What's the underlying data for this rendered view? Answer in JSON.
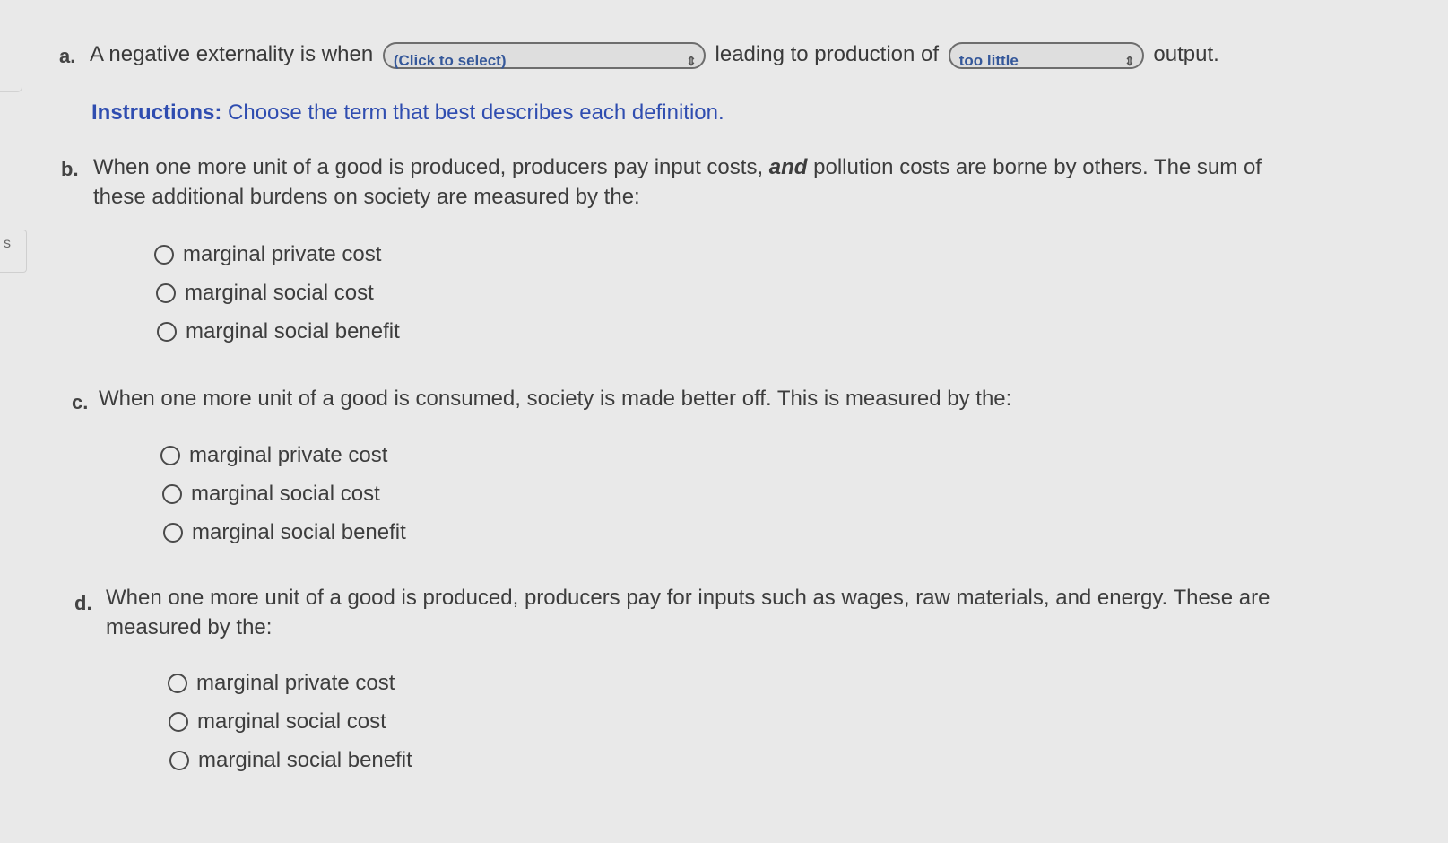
{
  "side_tab": {
    "text": "s"
  },
  "question_a": {
    "letter": "a.",
    "text_before": "A negative externality is when",
    "select1": {
      "value": "(Click to select)"
    },
    "text_middle": "leading to production of",
    "select2": {
      "value": "too little"
    },
    "text_after": "output."
  },
  "instructions": {
    "bold": "Instructions:",
    "text": "Choose the term that best describes each definition."
  },
  "question_b": {
    "letter": "b.",
    "line1_a": "When one more unit of a good is produced, producers pay input costs,",
    "line1_em": "and",
    "line1_b": "pollution costs are borne by others. The sum of",
    "line2": "these additional burdens on society are measured by the:",
    "options": [
      "marginal private cost",
      "marginal social cost",
      "marginal social benefit"
    ]
  },
  "question_c": {
    "letter": "c.",
    "text": "When one more unit of a good is consumed, society is made better off. This is measured by the:",
    "options": [
      "marginal private cost",
      "marginal social cost",
      "marginal social benefit"
    ]
  },
  "question_d": {
    "letter": "d.",
    "line1": "When one more unit of a good is produced, producers pay for inputs such as wages, raw materials, and energy. These are",
    "line2": "measured by the:",
    "options": [
      "marginal private cost",
      "marginal social cost",
      "marginal social benefit"
    ]
  }
}
